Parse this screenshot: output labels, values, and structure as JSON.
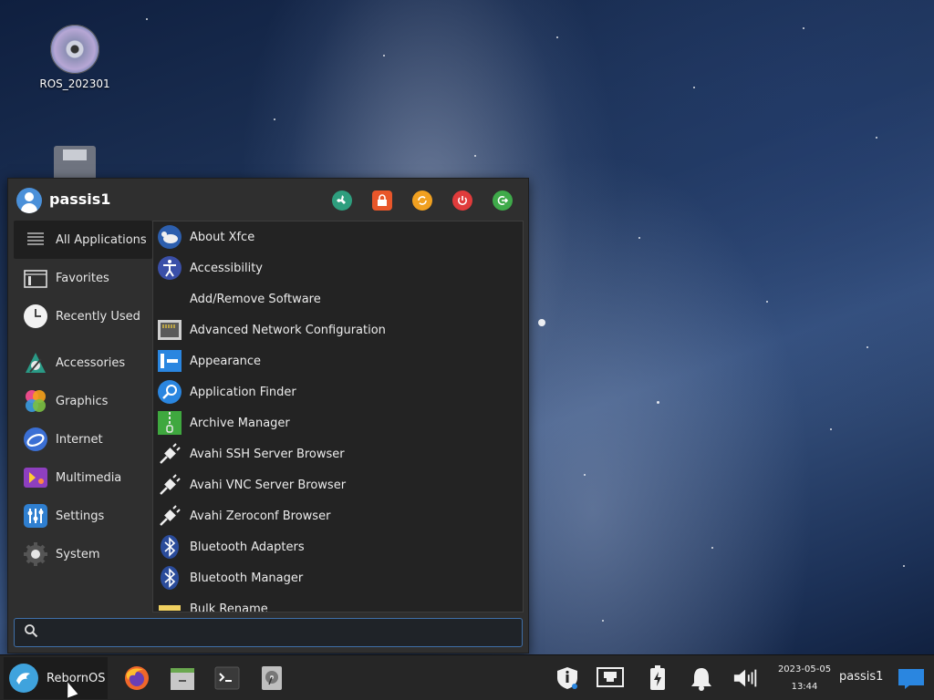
{
  "desktop": {
    "icons": [
      {
        "label": "ROS_202301",
        "icon": "optical-disc-icon"
      },
      {
        "label": "",
        "icon": "floppy-drive-icon"
      }
    ]
  },
  "menu": {
    "username": "passis1",
    "header_actions": [
      {
        "name": "settings-manager-icon",
        "color": "#2e9e7e"
      },
      {
        "name": "lock-screen-icon",
        "color": "#e8562a"
      },
      {
        "name": "switch-user-icon",
        "color": "#f0a020"
      },
      {
        "name": "power-icon",
        "color": "#e03b3b"
      },
      {
        "name": "logout-icon",
        "color": "#3faa4a"
      }
    ],
    "categories": [
      {
        "label": "All Applications",
        "icon": "list-icon"
      },
      {
        "label": "Favorites",
        "icon": "folder-icon"
      },
      {
        "label": "Recently Used",
        "icon": "clock-icon"
      },
      {
        "label": "Accessories",
        "icon": "accessories-icon"
      },
      {
        "label": "Graphics",
        "icon": "graphics-icon"
      },
      {
        "label": "Internet",
        "icon": "internet-icon"
      },
      {
        "label": "Multimedia",
        "icon": "multimedia-icon"
      },
      {
        "label": "Settings",
        "icon": "settings-icon"
      },
      {
        "label": "System",
        "icon": "system-gear-icon"
      }
    ],
    "apps": [
      {
        "label": "About Xfce",
        "icon": "xfce-mouse-icon"
      },
      {
        "label": "Accessibility",
        "icon": "accessibility-icon"
      },
      {
        "label": "Add/Remove Software",
        "icon": ""
      },
      {
        "label": "Advanced Network Configuration",
        "icon": "network-port-icon"
      },
      {
        "label": "Appearance",
        "icon": "appearance-icon"
      },
      {
        "label": "Application Finder",
        "icon": "magnifier-icon"
      },
      {
        "label": "Archive Manager",
        "icon": "archive-icon"
      },
      {
        "label": "Avahi SSH Server Browser",
        "icon": "plug-icon"
      },
      {
        "label": "Avahi VNC Server Browser",
        "icon": "plug-icon"
      },
      {
        "label": "Avahi Zeroconf Browser",
        "icon": "plug-icon"
      },
      {
        "label": "Bluetooth Adapters",
        "icon": "bluetooth-icon"
      },
      {
        "label": "Bluetooth Manager",
        "icon": "bluetooth-icon"
      },
      {
        "label": "Bulk Rename",
        "icon": "bulk-rename-icon"
      }
    ],
    "search": {
      "value": "",
      "placeholder": ""
    }
  },
  "taskbar": {
    "start_label": "RebornOS",
    "launchers": [
      "firefox-icon",
      "file-manager-icon",
      "terminal-icon",
      "disk-utility-icon"
    ],
    "tray": [
      "security-shield-icon",
      "network-wired-icon",
      "power-battery-icon",
      "notification-bell-icon",
      "volume-icon"
    ],
    "date": "2023-05-05",
    "time": "13:44",
    "user": "passis1",
    "show_desktop_icon": "show-desktop-icon"
  }
}
